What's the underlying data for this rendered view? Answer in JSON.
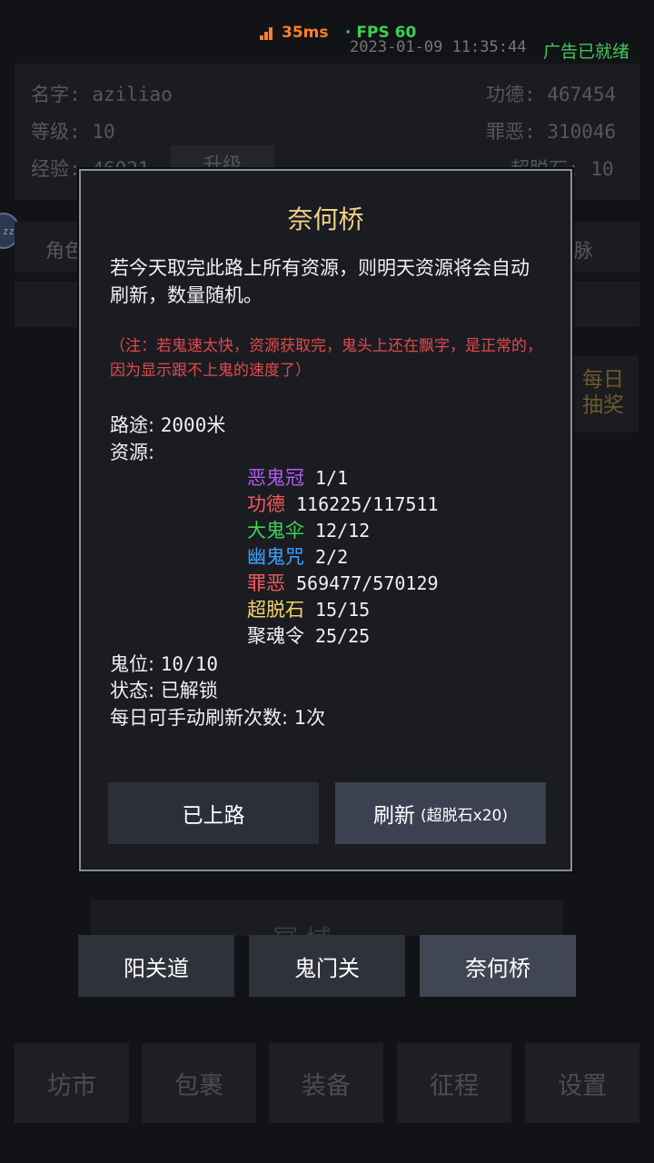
{
  "status": {
    "ping": "35ms",
    "fps": "· FPS 60",
    "datetime": "2023-01-09 11:35:44",
    "ad": "广告已就绪"
  },
  "background": {
    "name_label": "名字:",
    "name_value": "aziliao",
    "merit_label": "功德:",
    "merit_value": "467454",
    "level_label": "等级:",
    "level_value": "10",
    "sin_label": "罪恶:",
    "sin_value": "310046",
    "exp_label": "经验:",
    "exp_value": "46021",
    "upgrade": "升级",
    "stone_label": "超脱石:",
    "stone_value": "10",
    "avatar_text": "zz",
    "role_tab": "角色",
    "right_tab": "脉",
    "daily_line1": "每日",
    "daily_line2": "抽奖",
    "realm": "冥 域"
  },
  "modal": {
    "title": "奈何桥",
    "desc": "若今天取完此路上所有资源，则明天资源将会自动刷新，数量随机。",
    "note": "（注：若鬼速太快，资源获取完，鬼头上还在飘字，是正常的，因为显示跟不上鬼的速度了）",
    "distance_label": "路途:",
    "distance_value": "2000米",
    "resources_label": "资源:",
    "resources": [
      {
        "name": "恶鬼冠",
        "count": "1/1",
        "color": "#b15cf0"
      },
      {
        "name": "功德",
        "count": "116225/117511",
        "color": "#f05a5a"
      },
      {
        "name": "大鬼伞",
        "count": "12/12",
        "color": "#3fd35b"
      },
      {
        "name": "幽鬼咒",
        "count": "2/2",
        "color": "#3ea1ff"
      },
      {
        "name": "罪恶",
        "count": "569477/570129",
        "color": "#f05a5a"
      },
      {
        "name": "超脱石",
        "count": "15/15",
        "color": "#f2d36a"
      },
      {
        "name": "聚魂令",
        "count": "25/25",
        "color": "#f0f0f0"
      }
    ],
    "slots_label": "鬼位:",
    "slots_value": "10/10",
    "state_label": "状态:",
    "state_value": "已解锁",
    "refresh_label": "每日可手动刷新次数:",
    "refresh_value": "1次",
    "btn_go": "已上路",
    "btn_refresh": "刷新",
    "btn_refresh_cost": "(超脱石x20)"
  },
  "nav": [
    "阳关道",
    "鬼门关",
    "奈何桥"
  ],
  "tabs": [
    "坊市",
    "包裹",
    "装备",
    "征程",
    "设置"
  ]
}
